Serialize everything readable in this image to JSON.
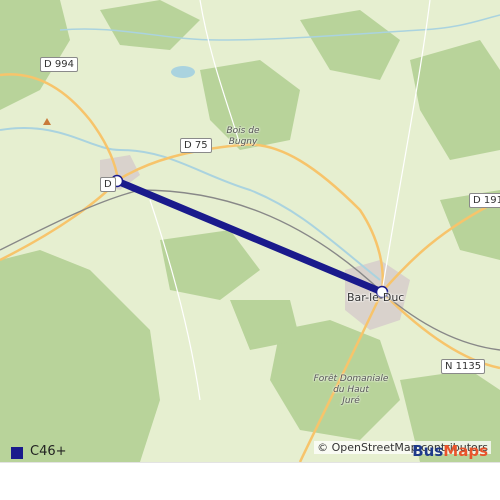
{
  "map": {
    "road_labels": [
      {
        "text": "D 994",
        "ref": "d994"
      },
      {
        "text": "D 75",
        "ref": "d75"
      },
      {
        "text": "D",
        "ref": "d-left"
      },
      {
        "text": "D 191",
        "ref": "d191"
      },
      {
        "text": "N 1135",
        "ref": "n1135"
      }
    ],
    "places": {
      "bois_de_bugny": "Bois de\nBugny",
      "bar_le_duc": "Bar-le-Duc",
      "foret": "Forêt Domaniale\ndu Haut\nJuré"
    },
    "attribution": "© OpenStreetMap contributors",
    "route_color": "#1a1a8c"
  },
  "legend": {
    "route_name": "C46+",
    "route_color": "#1a1a8c"
  },
  "brand": {
    "part1": "Bus",
    "part2": "Maps"
  }
}
